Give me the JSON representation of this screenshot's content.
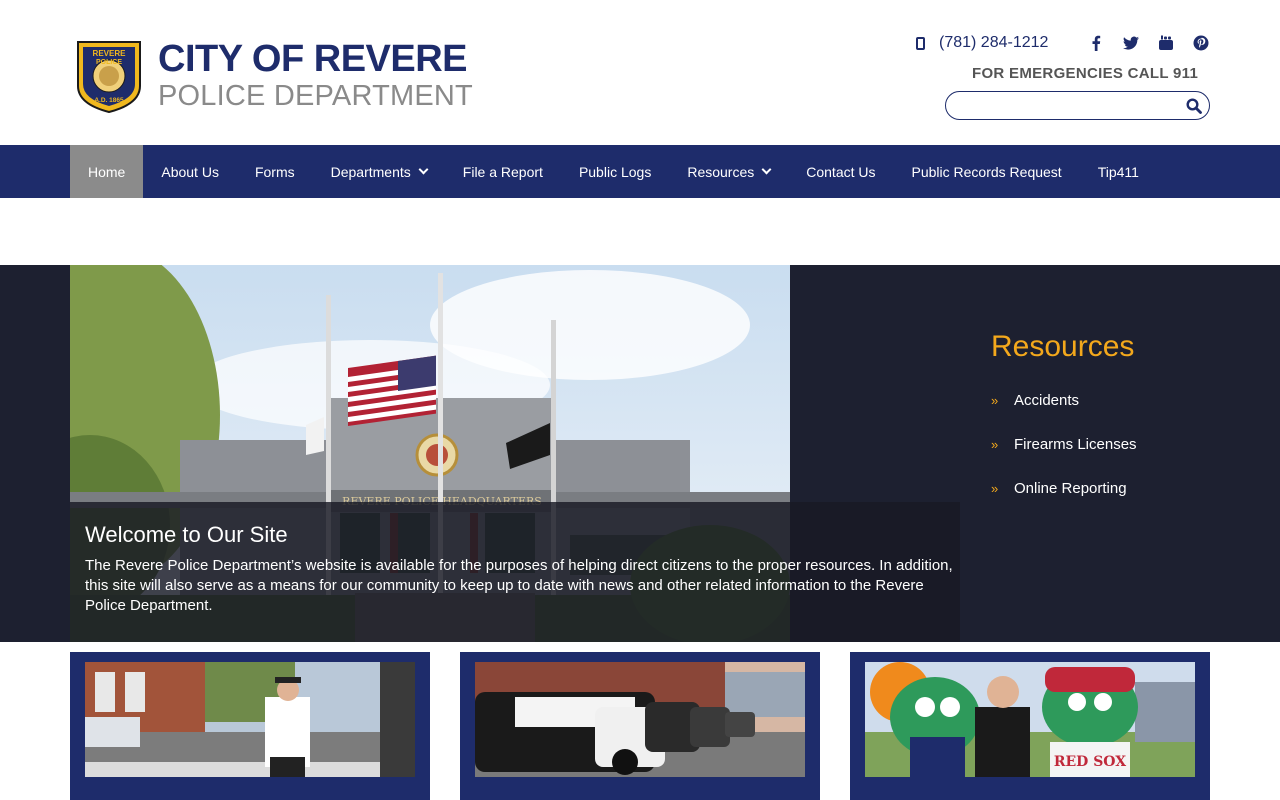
{
  "header": {
    "logo": {
      "badge_text_top": "REVERE",
      "badge_text_mid": "POLICE",
      "badge_text_bottom": "A.D. 1865",
      "line1": "CITY OF REVERE",
      "line2": "POLICE DEPARTMENT"
    },
    "phone": "(781) 284-1212",
    "emergency": "FOR EMERGENCIES CALL 911",
    "social": [
      "facebook-icon",
      "twitter-icon",
      "youtube-icon",
      "pinterest-icon"
    ],
    "search": {
      "value": "",
      "placeholder": ""
    }
  },
  "nav": {
    "items": [
      {
        "label": "Home",
        "active": true
      },
      {
        "label": "About Us"
      },
      {
        "label": "Forms"
      },
      {
        "label": "Departments",
        "dropdown": true
      },
      {
        "label": "File a Report"
      },
      {
        "label": "Public Logs"
      },
      {
        "label": "Resources",
        "dropdown": true
      },
      {
        "label": "Contact Us"
      },
      {
        "label": "Public Records Request"
      },
      {
        "label": "Tip411"
      }
    ]
  },
  "hero": {
    "title": "Welcome to Our Site",
    "text": "The Revere Police Department’s website is available for the purposes of helping direct citizens to the proper resources. In addition, this site will also serve as a means for our community to keep up to date with news and other related information to the Revere Police Department.",
    "building_sign": "REVERE POLICE HEADQUARTERS"
  },
  "resources": {
    "title": "Resources",
    "items": [
      "Accidents",
      "Firearms Licenses",
      "Online Reporting"
    ]
  },
  "colors": {
    "navy": "#1e2c6b",
    "accent": "#f3a81c",
    "dark_panel": "#1d2030",
    "active_nav": "#8b8b8b"
  }
}
